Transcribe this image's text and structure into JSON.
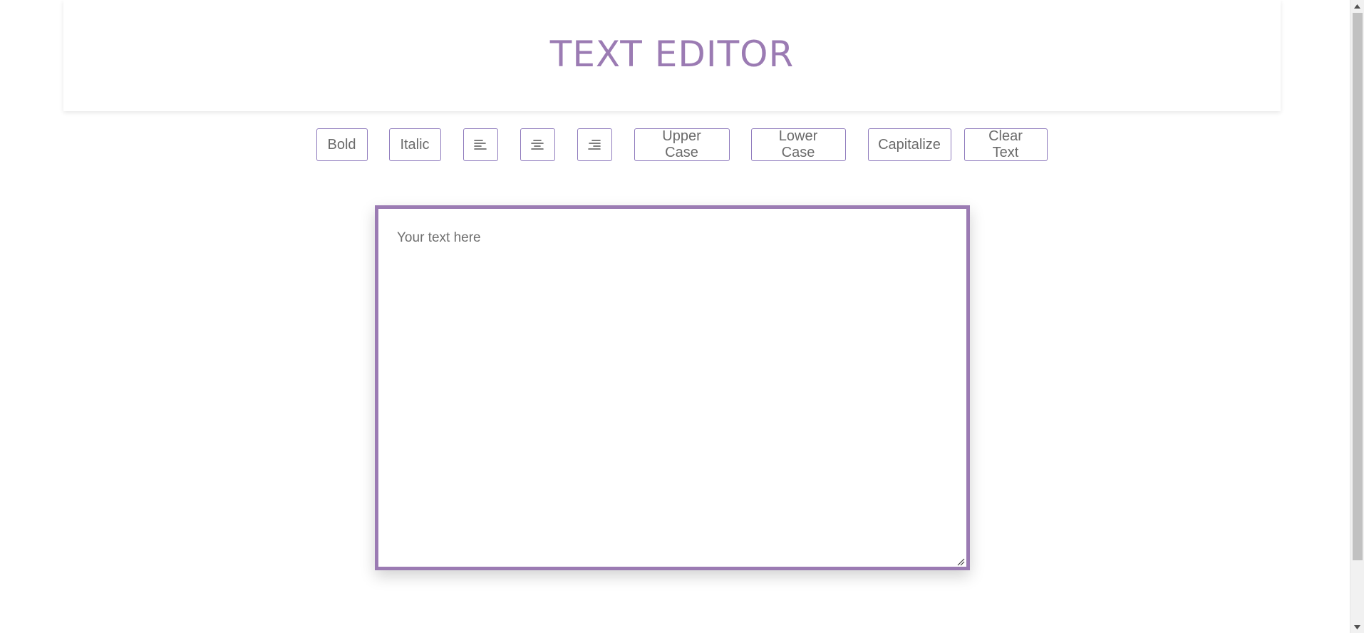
{
  "header": {
    "title": "TEXT EDITOR"
  },
  "toolbar": {
    "bold_label": "Bold",
    "italic_label": "Italic",
    "align_left_icon": "align-left-icon",
    "align_center_icon": "align-center-icon",
    "align_right_icon": "align-right-icon",
    "upper_case_label": "Upper Case",
    "lower_case_label": "Lower Case",
    "capitalize_label": "Capitalize",
    "clear_text_label": "Clear Text"
  },
  "editor": {
    "placeholder": "Your text here",
    "value": ""
  },
  "colors": {
    "accent": "#9b7bb3",
    "button_border": "#8f7bbd",
    "button_text": "#6b6b6b"
  }
}
